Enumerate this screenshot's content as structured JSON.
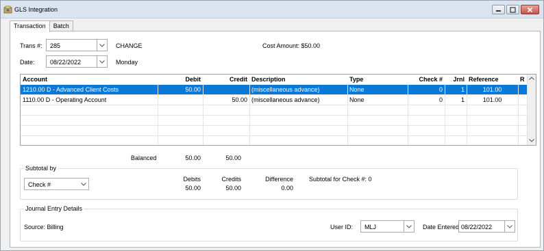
{
  "window": {
    "title": "GLS Integration",
    "controls": {
      "minimize": "minimize",
      "maximize": "maximize",
      "close": "close"
    }
  },
  "tabs": [
    {
      "label": "Transaction",
      "active": true
    },
    {
      "label": "Batch",
      "active": false
    }
  ],
  "transaction": {
    "trans_label": "Trans #:",
    "trans_value": "285",
    "mode": "CHANGE",
    "cost_amount": "Cost Amount: $50.00",
    "date_label": "Date:",
    "date_value": "08/22/2022",
    "weekday": "Monday"
  },
  "grid": {
    "columns": [
      "Account",
      "Debit",
      "Credit",
      "Description",
      "Type",
      "Check #",
      "Jrnl",
      "Reference",
      "R"
    ],
    "rows": [
      {
        "account": "1210.00 D - Advanced Client Costs",
        "debit": "50.00",
        "credit": "",
        "description": "(miscellaneous advance)",
        "type": "None",
        "check": "0",
        "jrnl": "1",
        "reference": "101.00",
        "r": "",
        "selected": true
      },
      {
        "account": "1110.00 D - Operating Account",
        "debit": "",
        "credit": "50.00",
        "description": "(miscellaneous advance)",
        "type": "None",
        "check": "0",
        "jrnl": "1",
        "reference": "101.00",
        "r": "",
        "selected": false
      }
    ]
  },
  "totals": {
    "label": "Balanced",
    "debit": "50.00",
    "credit": "50.00"
  },
  "subtotal": {
    "title": "Subtotal by",
    "select_value": "Check #",
    "debits_label": "Debits",
    "credits_label": "Credits",
    "difference_label": "Difference",
    "check_label": "Subtotal for Check #: 0",
    "debits_value": "50.00",
    "credits_value": "50.00",
    "difference_value": "0.00"
  },
  "journal": {
    "title": "Journal Entry Details",
    "source": "Source: Billing",
    "user_label": "User ID:",
    "user_value": "MLJ",
    "date_label": "Date Entered:",
    "date_value": "08/22/2022"
  },
  "colors": {
    "selection": "#0a78d7",
    "titlebar": "#dbe5f2"
  }
}
